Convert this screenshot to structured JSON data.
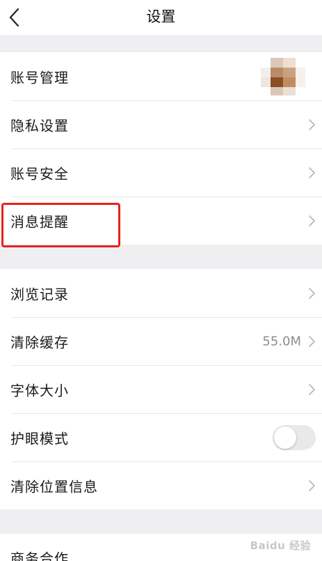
{
  "header": {
    "title": "设置"
  },
  "groups": [
    {
      "items": [
        {
          "label": "账号管理"
        },
        {
          "label": "隐私设置"
        },
        {
          "label": "账号安全"
        },
        {
          "label": "消息提醒"
        }
      ]
    },
    {
      "items": [
        {
          "label": "浏览记录"
        },
        {
          "label": "清除缓存",
          "value": "55.0M"
        },
        {
          "label": "字体大小"
        },
        {
          "label": "护眼模式",
          "toggle_on": false
        },
        {
          "label": "清除位置信息"
        }
      ]
    },
    {
      "items": [
        {
          "label": "商务合作"
        }
      ]
    }
  ],
  "watermark": "Baidu 经验",
  "colors": {
    "highlight": "#e8201e",
    "background": "#efeff2",
    "separator": "#e6e6e8"
  }
}
